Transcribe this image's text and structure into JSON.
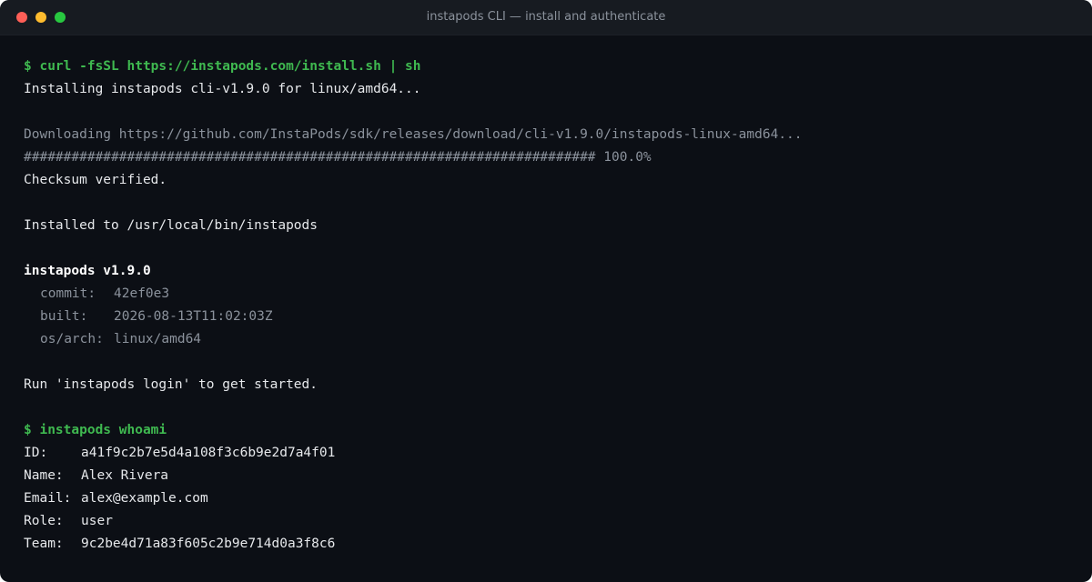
{
  "window": {
    "title": "instapods CLI — install and authenticate"
  },
  "install": {
    "command": "$ curl -fsSL https://instapods.com/install.sh | sh",
    "installing": "Installing instapods cli-v1.9.0 for linux/amd64...",
    "downloading": "Downloading https://github.com/InstaPods/sdk/releases/download/cli-v1.9.0/instapods-linux-amd64...",
    "progress_bar": "########################################################################",
    "progress_percent": "100.0%",
    "progress_value": 1.0,
    "checksum": "Checksum verified.",
    "installed_to": "Installed to /usr/local/bin/instapods"
  },
  "version": {
    "header": "instapods v1.9.0",
    "commit_label": "commit:",
    "commit_value": "42ef0e3",
    "built_label": "built:",
    "built_value": "2026-08-13T11:02:03Z",
    "arch_label": "os/arch:",
    "arch_value": "linux/amd64"
  },
  "hint": "Run 'instapods login' to get started.",
  "whoami": {
    "command": "$ instapods whoami",
    "rows": [
      {
        "label": "ID:",
        "value": "a41f9c2b7e5d4a108f3c6b9e2d7a4f01"
      },
      {
        "label": "Name:",
        "value": "Alex Rivera"
      },
      {
        "label": "Email:",
        "value": "alex@example.com"
      },
      {
        "label": "Role:",
        "value": "user"
      },
      {
        "label": "Team:",
        "value": "9c2be4d71a83f605c2b9e714d0a3f8c6"
      }
    ]
  },
  "colors": {
    "prompt": "#3fb950",
    "background": "#0c0f15",
    "dim": "#8b929c"
  }
}
